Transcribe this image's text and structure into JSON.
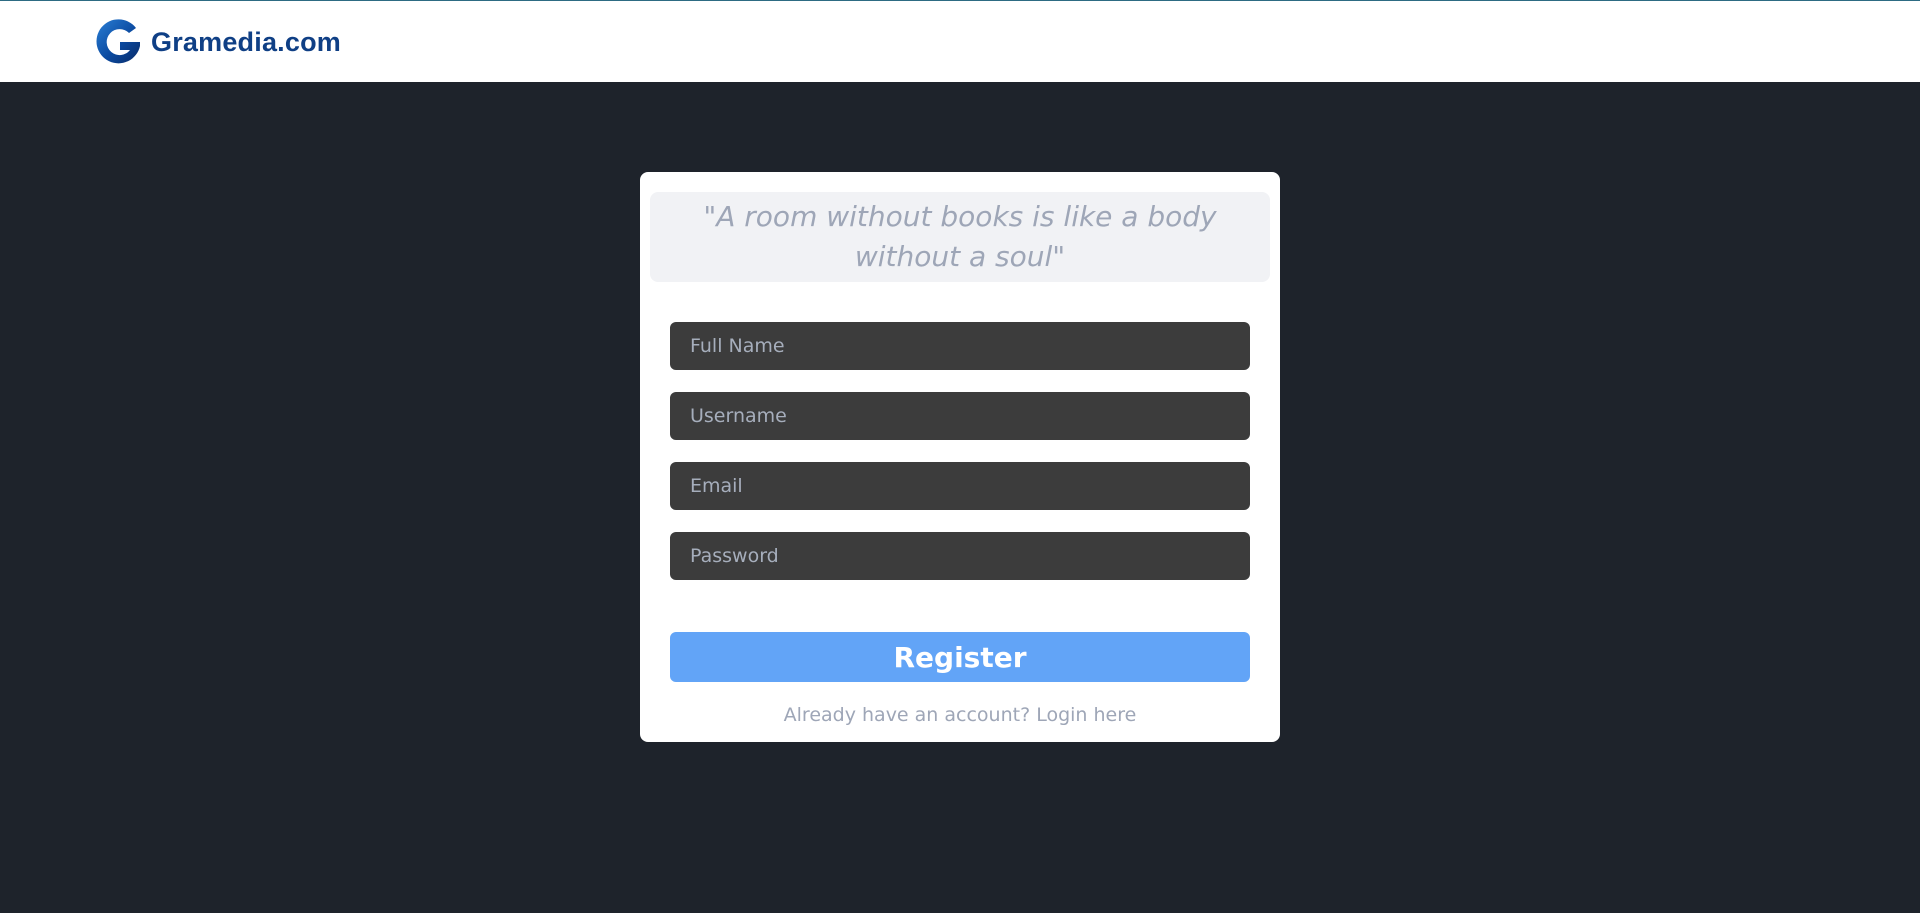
{
  "header": {
    "logo_text": "Gramedia.com",
    "logo_icon": "gramedia-g-icon"
  },
  "register_card": {
    "quote": "\"A room without books is like a body without a soul\"",
    "fields": {
      "full_name_placeholder": "Full Name",
      "username_placeholder": "Username",
      "email_placeholder": "Email",
      "password_placeholder": "Password"
    },
    "register_label": "Register",
    "login_link": "Already have an account? Login here"
  },
  "colors": {
    "page_background": "#1e232b",
    "header_background": "#ffffff",
    "brand_blue": "#0f3f85",
    "input_background": "#3c3c3c",
    "button_background": "#62a4f7",
    "muted_text": "#9ea6b7"
  }
}
